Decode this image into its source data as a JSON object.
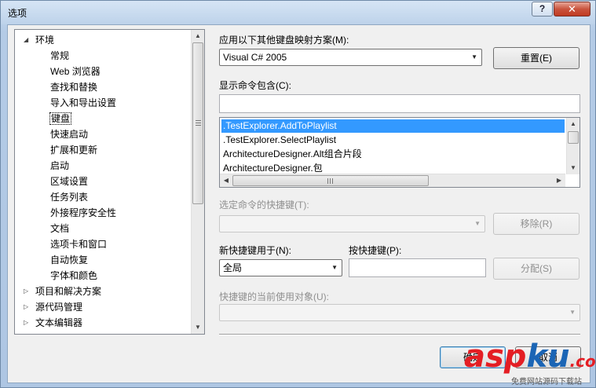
{
  "window": {
    "title": "选项",
    "help": "?",
    "close": "✕"
  },
  "tree": {
    "items": [
      {
        "label": "环境",
        "level": 0,
        "expanded": true
      },
      {
        "label": "常规",
        "level": 1
      },
      {
        "label": "Web 浏览器",
        "level": 1
      },
      {
        "label": "查找和替换",
        "level": 1
      },
      {
        "label": "导入和导出设置",
        "level": 1
      },
      {
        "label": "键盘",
        "level": 1,
        "selected": true
      },
      {
        "label": "快速启动",
        "level": 1
      },
      {
        "label": "扩展和更新",
        "level": 1
      },
      {
        "label": "启动",
        "level": 1
      },
      {
        "label": "区域设置",
        "level": 1
      },
      {
        "label": "任务列表",
        "level": 1
      },
      {
        "label": "外接程序安全性",
        "level": 1
      },
      {
        "label": "文档",
        "level": 1
      },
      {
        "label": "选项卡和窗口",
        "level": 1
      },
      {
        "label": "自动恢复",
        "level": 1
      },
      {
        "label": "字体和颜色",
        "level": 1
      },
      {
        "label": "项目和解决方案",
        "level": 0,
        "expanded": false
      },
      {
        "label": "源代码管理",
        "level": 0,
        "expanded": false
      },
      {
        "label": "文本编辑器",
        "level": 0,
        "expanded": false
      }
    ]
  },
  "keyboard": {
    "scheme_label": "应用以下其他键盘映射方案(M):",
    "scheme_value": "Visual C# 2005",
    "reset_button": "重置(E)",
    "show_commands_label": "显示命令包含(C):",
    "commands_filter_value": "",
    "commands": [
      {
        "label": ".TestExplorer.AddToPlaylist",
        "selected": true
      },
      {
        "label": ".TestExplorer.SelectPlaylist"
      },
      {
        "label": "ArchitectureDesigner.Alt组合片段"
      },
      {
        "label": "ArchitectureDesigner.包"
      }
    ],
    "shortcuts_label": "选定命令的快捷键(T):",
    "shortcuts_value": "",
    "remove_button": "移除(R)",
    "use_new_in_label": "新快捷键用于(N):",
    "use_new_in_value": "全局",
    "press_keys_label": "按快捷键(P):",
    "press_keys_value": "",
    "assign_button": "分配(S)",
    "currently_used_label": "快捷键的当前使用对象(U):",
    "currently_used_value": ""
  },
  "footer": {
    "ok_button": "确定",
    "cancel_button": "取消"
  },
  "watermark": {
    "asp": "asp",
    "ku": "ku",
    "com": ".com",
    "sub": "免费网站源码下载站"
  }
}
